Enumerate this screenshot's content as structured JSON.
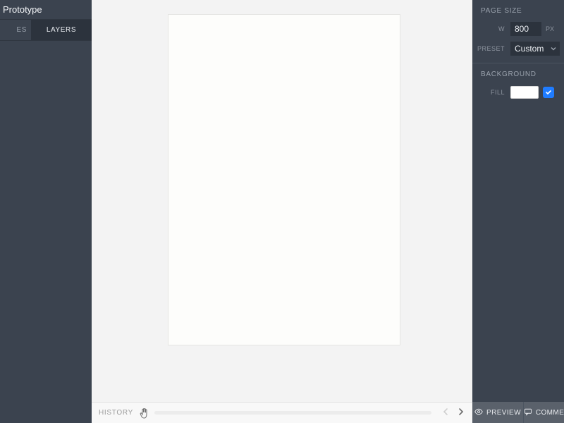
{
  "leftbar": {
    "title": "Prototype",
    "tabs": [
      {
        "label": "ES",
        "active": false
      },
      {
        "label": "LAYERS",
        "active": true
      }
    ]
  },
  "rightbar": {
    "page_size": {
      "title": "PAGE SIZE",
      "w_label": "W",
      "w_value": "800",
      "w_unit": "PX",
      "preset_label": "PRESET",
      "preset_value": "Custom"
    },
    "background": {
      "title": "BACKGROUND",
      "fill_label": "FILL",
      "fill_color": "#ffffff",
      "fill_enabled": true
    }
  },
  "bottombar": {
    "history_label": "HISTORY",
    "preview_label": "PREVIEW",
    "comment_label": "COMME"
  }
}
